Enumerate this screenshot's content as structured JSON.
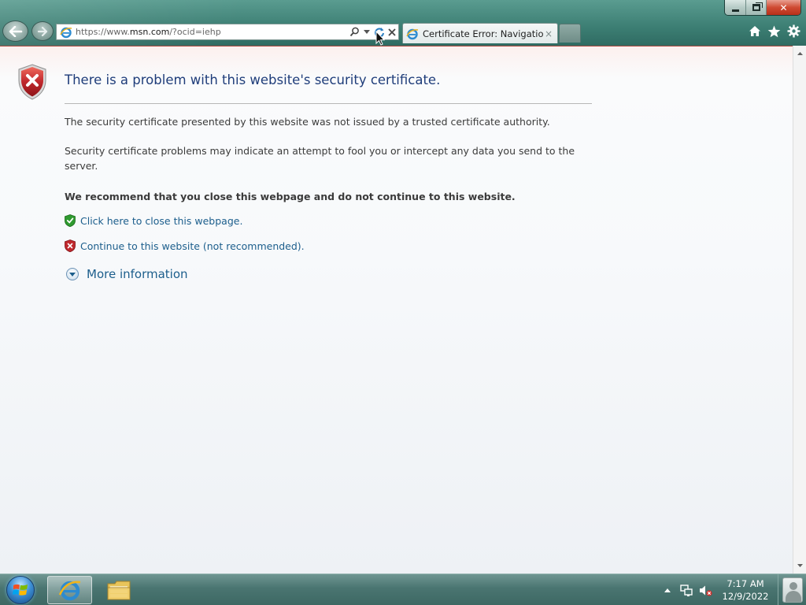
{
  "window": {
    "caption": {
      "minimize_label": "",
      "maximize_label": "",
      "close_label": "✕"
    }
  },
  "browser": {
    "address": {
      "prefix": "https://www.",
      "domain": "msn.com",
      "suffix": "/?ocid=iehp"
    },
    "tab": {
      "title": "Certificate Error: Navigation...",
      "close_glyph": "×"
    },
    "toolbar_icons": [
      "home-icon",
      "favorites-star-icon",
      "tools-gear-icon"
    ]
  },
  "page": {
    "title": "There is a problem with this website's security certificate.",
    "paragraph_1": "The security certificate presented by this website was not issued by a trusted certificate authority.",
    "paragraph_2": "Security certificate problems may indicate an attempt to fool you or intercept any data you send to the server.",
    "recommendation": "We recommend that you close this webpage and do not continue to this website.",
    "close_link": "Click here to close this webpage.",
    "continue_link": "Continue to this website (not recommended).",
    "more_info_link": "More information"
  },
  "taskbar": {
    "apps": [
      "internet-explorer",
      "windows-explorer"
    ],
    "clock": {
      "time": "7:17 AM",
      "date": "12/9/2022"
    }
  },
  "colors": {
    "title_blue": "#1f3d7a",
    "link_blue": "#1c5e8c",
    "shield_red": "#c0282d",
    "shield_green": "#2f9a2f"
  }
}
